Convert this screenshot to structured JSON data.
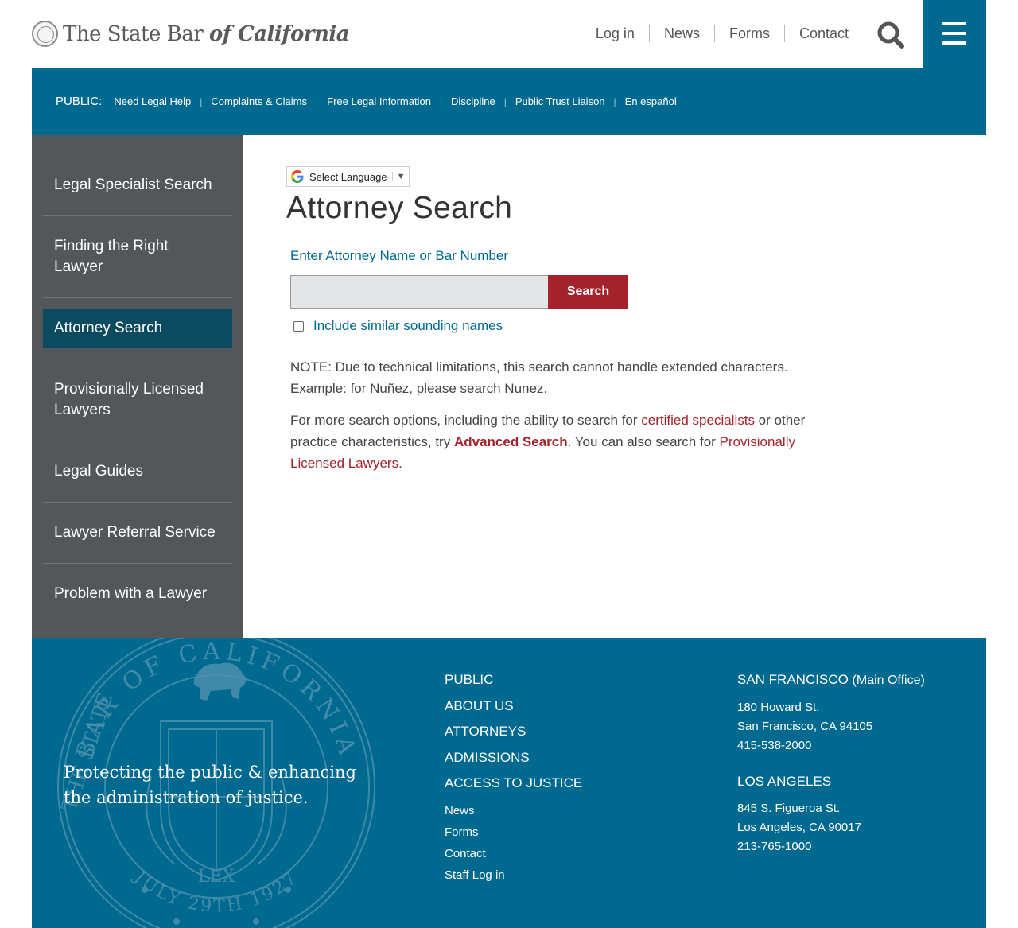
{
  "header": {
    "logo_text_plain": "The State Bar",
    "logo_text_italic": "of California",
    "nav": [
      "Log in",
      "News",
      "Forms",
      "Contact"
    ]
  },
  "public_bar": {
    "label": "PUBLIC:",
    "links": [
      "Need Legal Help",
      "Complaints & Claims",
      "Free Legal Information",
      "Discipline",
      "Public Trust Liaison",
      "En español"
    ]
  },
  "sidebar": {
    "items": [
      {
        "label": "Legal Specialist Search"
      },
      {
        "label": "Finding the Right Lawyer"
      },
      {
        "label": "Attorney Search"
      },
      {
        "label": "Provisionally Licensed Lawyers"
      },
      {
        "label": "Legal Guides"
      },
      {
        "label": "Lawyer Referral Service"
      },
      {
        "label": "Problem with a Lawyer"
      }
    ]
  },
  "main": {
    "translate_label": "Select Language",
    "translate_arrow": "▼",
    "title": "Attorney Search",
    "field_label": "Enter Attorney Name or Bar Number",
    "search_value": "",
    "search_button": "Search",
    "similar_label": "Include similar sounding names",
    "note_line1": "NOTE: Due to technical limitations, this search cannot handle extended characters.",
    "note_line2": "Example: for Nuñez, please search Nunez.",
    "more_text_1": "For more search options, including the ability to search for ",
    "more_link_1": "certified specialists",
    "more_text_2": " or other practice characteristics, try ",
    "more_link_2": "Advanced Search",
    "more_text_3": ". You can also search for ",
    "more_link_3": "Provisionally Licensed Lawyers."
  },
  "footer": {
    "tagline": "Protecting the public & enhancing the administration of justice.",
    "seal_text_top": "BAR OF CALIFORNIA",
    "seal_text_left": "THE STATE",
    "seal_text_bottom": "JULY 29TH 1927",
    "seal_text_lex": "LEX",
    "main_links": [
      "PUBLIC",
      "ABOUT US",
      "ATTORNEYS",
      "ADMISSIONS",
      "ACCESS TO JUSTICE"
    ],
    "sub_links": [
      "News",
      "Forms",
      "Contact",
      "Staff Log in"
    ],
    "office1": {
      "name": "SAN FRANCISCO",
      "suffix": "(Main Office)",
      "line1": "180 Howard St.",
      "line2": "San Francisco, CA 94105",
      "phone": "415-538-2000"
    },
    "office2": {
      "name": "LOS ANGELES",
      "line1": "845 S. Figueroa St.",
      "line2": "Los Angeles, CA 90017",
      "phone": "213-765-1000"
    }
  },
  "colors": {
    "brand_teal": "#00698f",
    "sidebar_gray": "#53575a",
    "active_navy": "#0c4a5f",
    "accent_red": "#a4222b"
  },
  "icons": [
    "state-bar-seal-icon",
    "search-icon",
    "hamburger-menu-icon",
    "google-g-icon",
    "chevron-down-icon",
    "state-bar-seal-watermark"
  ]
}
